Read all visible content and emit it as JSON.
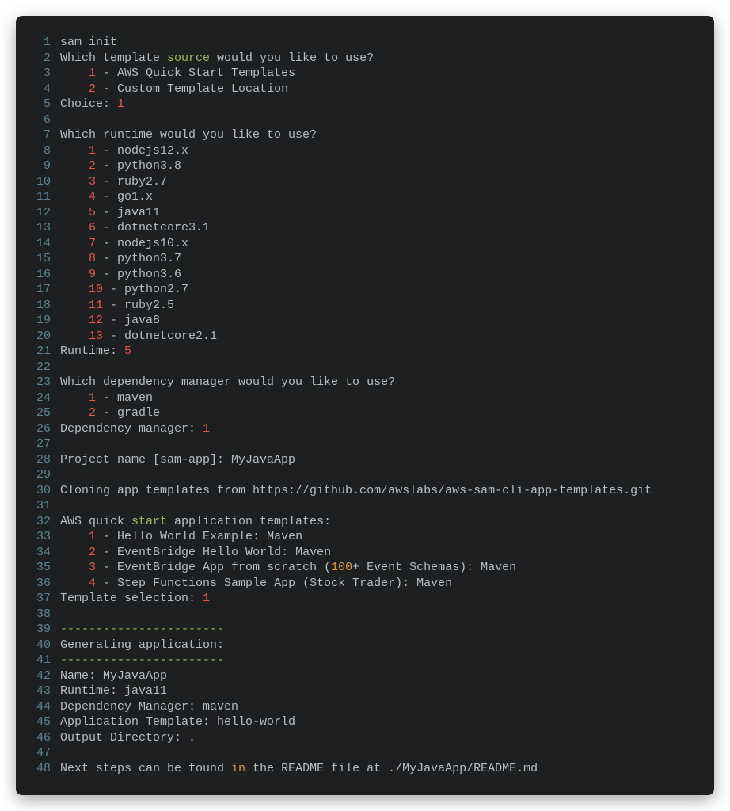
{
  "lines": [
    {
      "n": "1",
      "tokens": [
        {
          "t": "sam init"
        }
      ]
    },
    {
      "n": "2",
      "tokens": [
        {
          "t": "Which template "
        },
        {
          "t": "source",
          "c": "g"
        },
        {
          "t": " would you like to use?"
        }
      ]
    },
    {
      "n": "3",
      "tokens": [
        {
          "t": "    "
        },
        {
          "t": "1",
          "c": "r"
        },
        {
          "t": " - AWS Quick Start Templates"
        }
      ]
    },
    {
      "n": "4",
      "tokens": [
        {
          "t": "    "
        },
        {
          "t": "2",
          "c": "r"
        },
        {
          "t": " - Custom Template Location"
        }
      ]
    },
    {
      "n": "5",
      "tokens": [
        {
          "t": "Choice: "
        },
        {
          "t": "1",
          "c": "r"
        }
      ]
    },
    {
      "n": "6",
      "tokens": [
        {
          "t": ""
        }
      ]
    },
    {
      "n": "7",
      "tokens": [
        {
          "t": "Which runtime would you like to use?"
        }
      ]
    },
    {
      "n": "8",
      "tokens": [
        {
          "t": "    "
        },
        {
          "t": "1",
          "c": "r"
        },
        {
          "t": " - nodejs12.x"
        }
      ]
    },
    {
      "n": "9",
      "tokens": [
        {
          "t": "    "
        },
        {
          "t": "2",
          "c": "r"
        },
        {
          "t": " - python3.8"
        }
      ]
    },
    {
      "n": "10",
      "tokens": [
        {
          "t": "    "
        },
        {
          "t": "3",
          "c": "r"
        },
        {
          "t": " - ruby2.7"
        }
      ]
    },
    {
      "n": "11",
      "tokens": [
        {
          "t": "    "
        },
        {
          "t": "4",
          "c": "r"
        },
        {
          "t": " - go1.x"
        }
      ]
    },
    {
      "n": "12",
      "tokens": [
        {
          "t": "    "
        },
        {
          "t": "5",
          "c": "r"
        },
        {
          "t": " - java11"
        }
      ]
    },
    {
      "n": "13",
      "tokens": [
        {
          "t": "    "
        },
        {
          "t": "6",
          "c": "r"
        },
        {
          "t": " - dotnetcore3.1"
        }
      ]
    },
    {
      "n": "14",
      "tokens": [
        {
          "t": "    "
        },
        {
          "t": "7",
          "c": "r"
        },
        {
          "t": " - nodejs10.x"
        }
      ]
    },
    {
      "n": "15",
      "tokens": [
        {
          "t": "    "
        },
        {
          "t": "8",
          "c": "r"
        },
        {
          "t": " - python3.7"
        }
      ]
    },
    {
      "n": "16",
      "tokens": [
        {
          "t": "    "
        },
        {
          "t": "9",
          "c": "r"
        },
        {
          "t": " - python3.6"
        }
      ]
    },
    {
      "n": "17",
      "tokens": [
        {
          "t": "    "
        },
        {
          "t": "10",
          "c": "r"
        },
        {
          "t": " - python2.7"
        }
      ]
    },
    {
      "n": "18",
      "tokens": [
        {
          "t": "    "
        },
        {
          "t": "11",
          "c": "r"
        },
        {
          "t": " - ruby2.5"
        }
      ]
    },
    {
      "n": "19",
      "tokens": [
        {
          "t": "    "
        },
        {
          "t": "12",
          "c": "r"
        },
        {
          "t": " - java8"
        }
      ]
    },
    {
      "n": "20",
      "tokens": [
        {
          "t": "    "
        },
        {
          "t": "13",
          "c": "r"
        },
        {
          "t": " - dotnetcore2.1"
        }
      ]
    },
    {
      "n": "21",
      "tokens": [
        {
          "t": "Runtime: "
        },
        {
          "t": "5",
          "c": "r"
        }
      ]
    },
    {
      "n": "22",
      "tokens": [
        {
          "t": ""
        }
      ]
    },
    {
      "n": "23",
      "tokens": [
        {
          "t": "Which dependency manager would you like to use?"
        }
      ]
    },
    {
      "n": "24",
      "tokens": [
        {
          "t": "    "
        },
        {
          "t": "1",
          "c": "r"
        },
        {
          "t": " - maven"
        }
      ]
    },
    {
      "n": "25",
      "tokens": [
        {
          "t": "    "
        },
        {
          "t": "2",
          "c": "r"
        },
        {
          "t": " - gradle"
        }
      ]
    },
    {
      "n": "26",
      "tokens": [
        {
          "t": "Dependency manager: "
        },
        {
          "t": "1",
          "c": "r"
        }
      ]
    },
    {
      "n": "27",
      "tokens": [
        {
          "t": ""
        }
      ]
    },
    {
      "n": "28",
      "tokens": [
        {
          "t": "Project name [sam-app]: MyJavaApp"
        }
      ]
    },
    {
      "n": "29",
      "tokens": [
        {
          "t": ""
        }
      ]
    },
    {
      "n": "30",
      "tokens": [
        {
          "t": "Cloning app templates from https://github.com/awslabs/aws-sam-cli-app-templates.git"
        }
      ]
    },
    {
      "n": "31",
      "tokens": [
        {
          "t": ""
        }
      ]
    },
    {
      "n": "32",
      "tokens": [
        {
          "t": "AWS quick "
        },
        {
          "t": "start",
          "c": "g"
        },
        {
          "t": " application templates:"
        }
      ]
    },
    {
      "n": "33",
      "tokens": [
        {
          "t": "    "
        },
        {
          "t": "1",
          "c": "r"
        },
        {
          "t": " - Hello World Example: Maven"
        }
      ]
    },
    {
      "n": "34",
      "tokens": [
        {
          "t": "    "
        },
        {
          "t": "2",
          "c": "r"
        },
        {
          "t": " - EventBridge Hello World: Maven"
        }
      ]
    },
    {
      "n": "35",
      "tokens": [
        {
          "t": "    "
        },
        {
          "t": "3",
          "c": "r"
        },
        {
          "t": " - EventBridge App from scratch ("
        },
        {
          "t": "100",
          "c": "o"
        },
        {
          "t": "+ Event Schemas): Maven"
        }
      ]
    },
    {
      "n": "36",
      "tokens": [
        {
          "t": "    "
        },
        {
          "t": "4",
          "c": "r"
        },
        {
          "t": " - Step Functions Sample App (Stock Trader): Maven"
        }
      ]
    },
    {
      "n": "37",
      "tokens": [
        {
          "t": "Template selection: "
        },
        {
          "t": "1",
          "c": "r"
        }
      ]
    },
    {
      "n": "38",
      "tokens": [
        {
          "t": ""
        }
      ]
    },
    {
      "n": "39",
      "tokens": [
        {
          "t": "-----------------------",
          "c": "g"
        }
      ]
    },
    {
      "n": "40",
      "tokens": [
        {
          "t": "Generating application:"
        }
      ]
    },
    {
      "n": "41",
      "tokens": [
        {
          "t": "-----------------------",
          "c": "g"
        }
      ]
    },
    {
      "n": "42",
      "tokens": [
        {
          "t": "Name: MyJavaApp"
        }
      ]
    },
    {
      "n": "43",
      "tokens": [
        {
          "t": "Runtime: java11"
        }
      ]
    },
    {
      "n": "44",
      "tokens": [
        {
          "t": "Dependency Manager: maven"
        }
      ]
    },
    {
      "n": "45",
      "tokens": [
        {
          "t": "Application Template: hello-world"
        }
      ]
    },
    {
      "n": "46",
      "tokens": [
        {
          "t": "Output Directory: ."
        }
      ]
    },
    {
      "n": "47",
      "tokens": [
        {
          "t": ""
        }
      ]
    },
    {
      "n": "48",
      "tokens": [
        {
          "t": "Next steps can be found "
        },
        {
          "t": "in",
          "c": "o"
        },
        {
          "t": " the README file at ./MyJavaApp/README.md"
        }
      ]
    }
  ]
}
